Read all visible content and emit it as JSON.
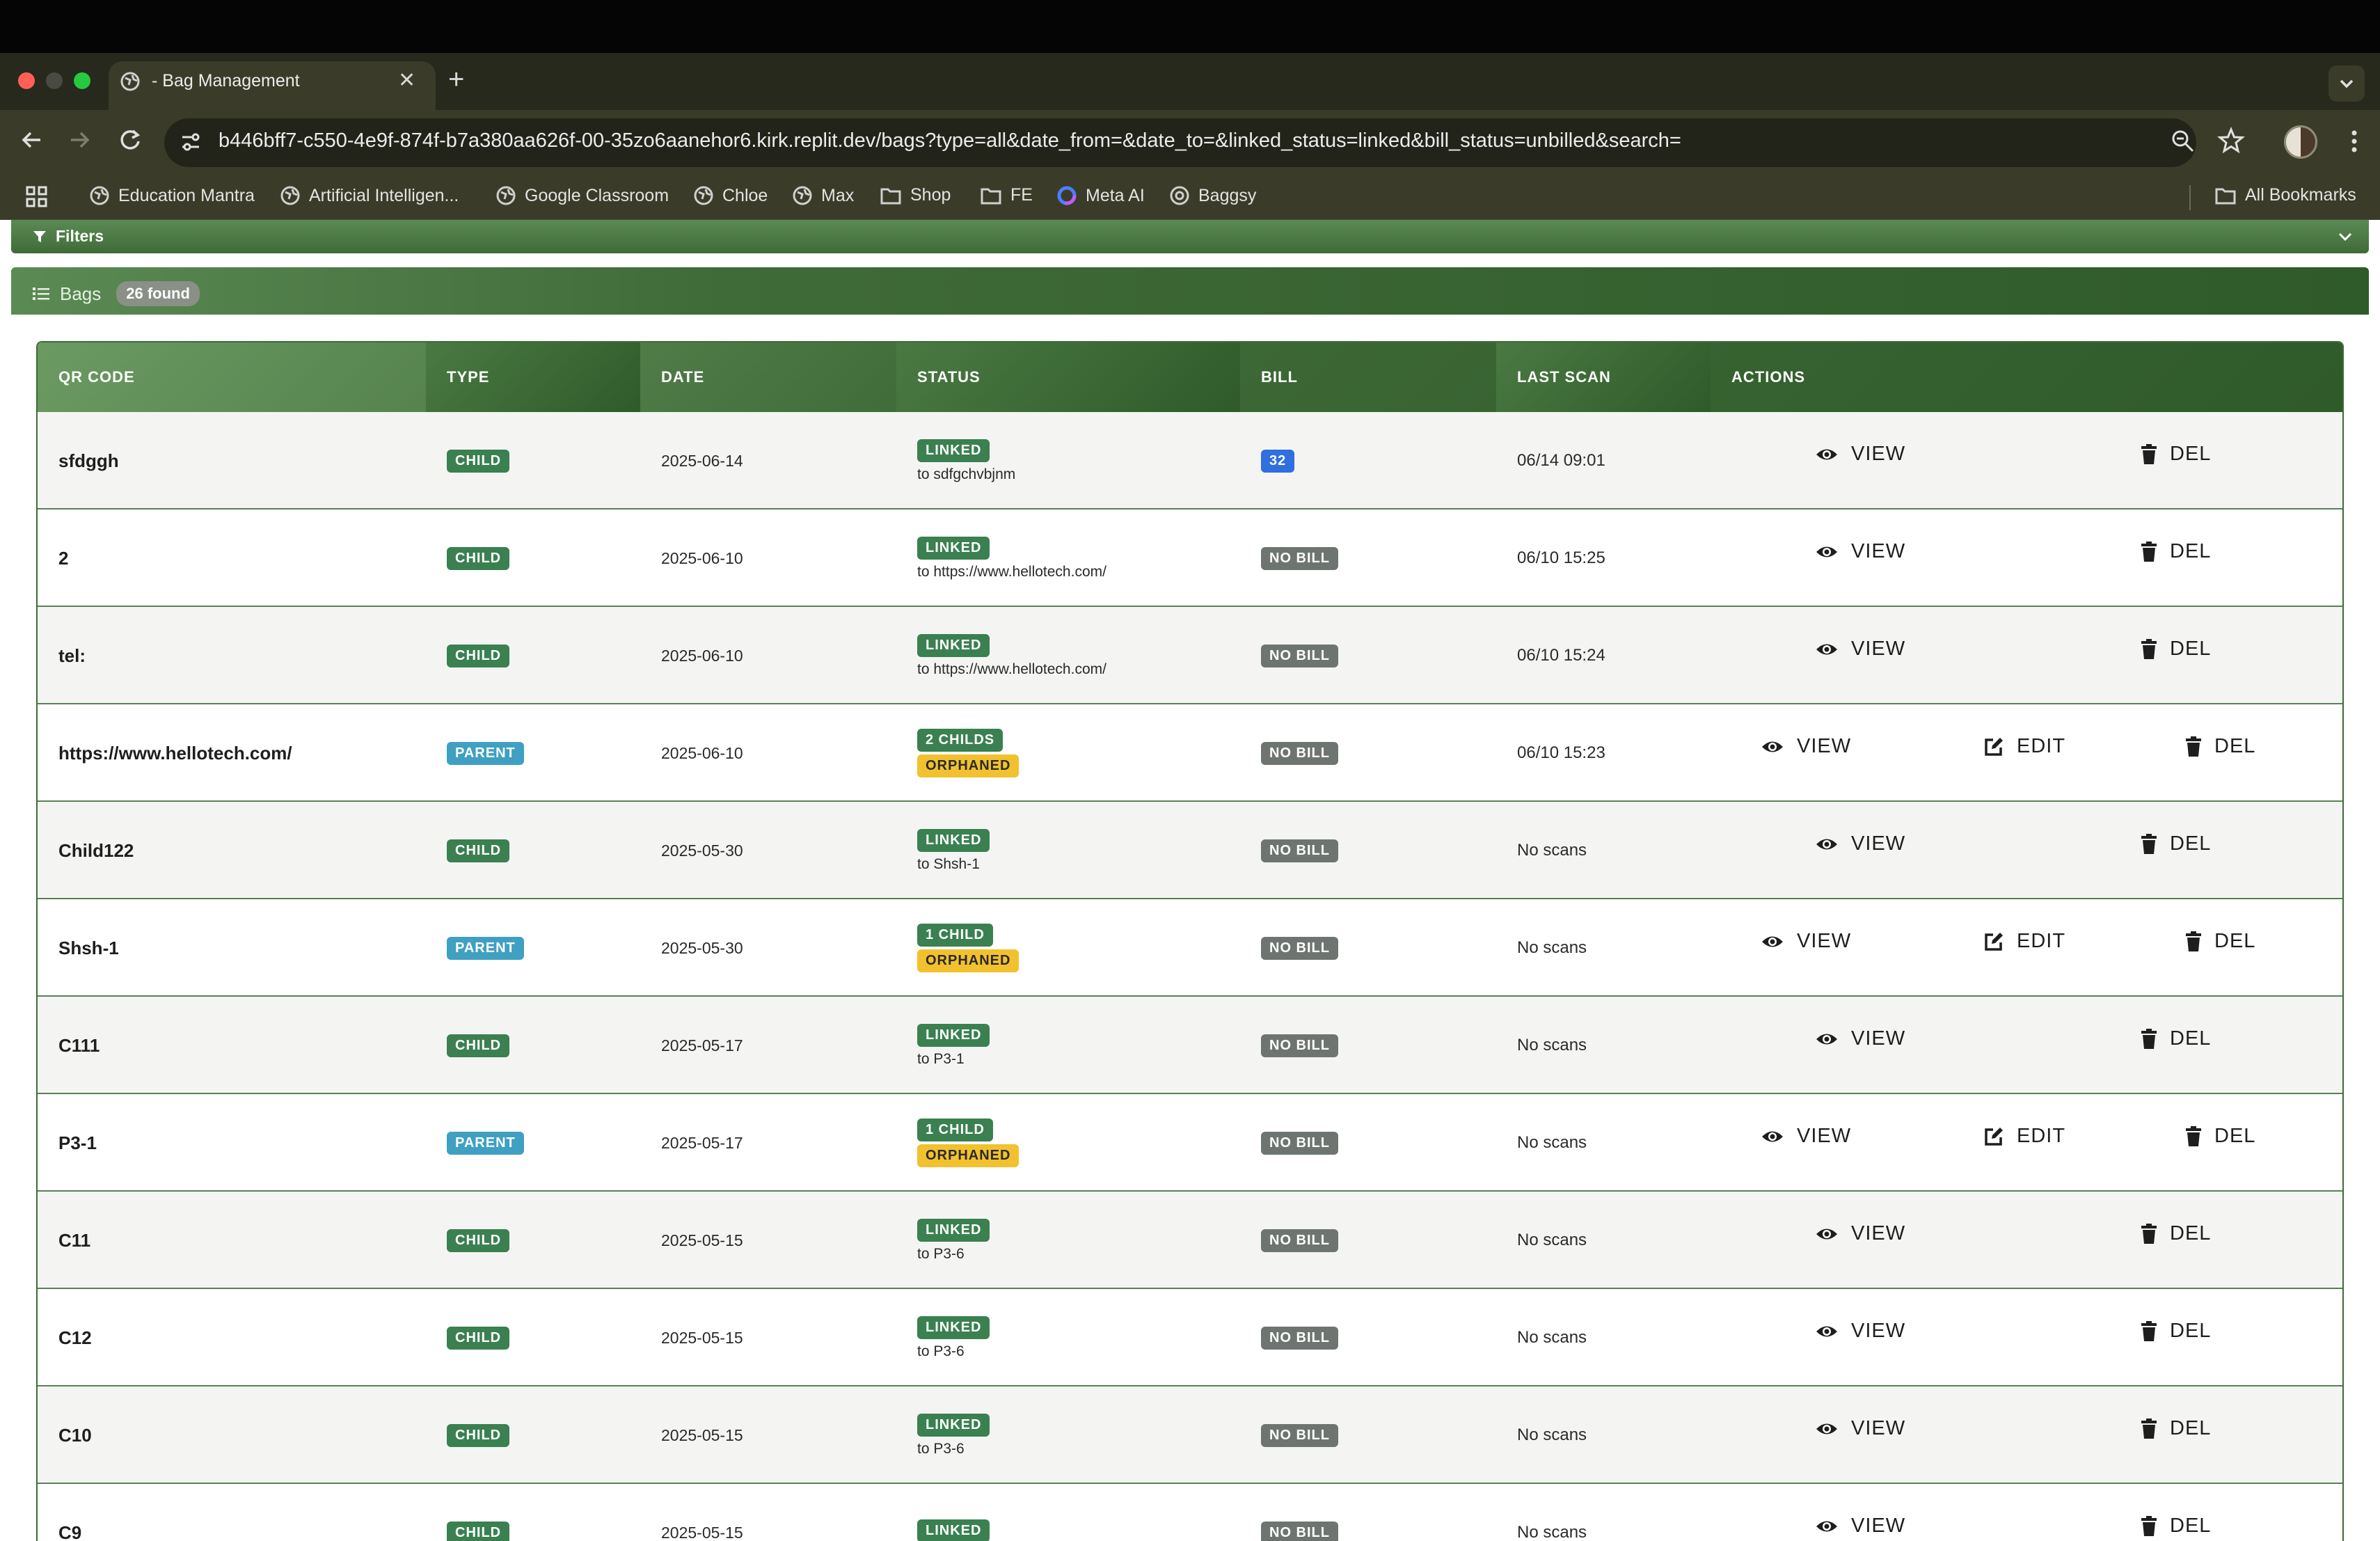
{
  "browser": {
    "tab_title": "- Bag Management",
    "url": "b446bff7-c550-4e9f-874f-b7a380aa626f-00-35zo6aanehor6.kirk.replit.dev/bags?type=all&date_from=&date_to=&linked_status=linked&bill_status=unbilled&search=",
    "bookmarks": [
      "Education Mantra",
      "Artificial Intelligen...",
      "Google Classroom",
      "Chloe",
      "Max",
      "Shop",
      "FE",
      "Meta AI",
      "Baggsy"
    ],
    "all_bookmarks": "All Bookmarks"
  },
  "filters": {
    "label": "Filters"
  },
  "bags": {
    "label": "Bags",
    "count": "26 found"
  },
  "table": {
    "headers": [
      "QR CODE",
      "TYPE",
      "DATE",
      "STATUS",
      "BILL",
      "LAST SCAN",
      "ACTIONS"
    ],
    "action_labels": {
      "view": "VIEW",
      "edit": "EDIT",
      "del": "DEL"
    },
    "rows": [
      {
        "qr": "sfdggh",
        "type": "CHILD",
        "date": "2025-06-14",
        "status": "LINKED",
        "status_sub": "to sdfgchvbjnm",
        "bill": "32",
        "last_scan": "06/14 09:01"
      },
      {
        "qr": "2",
        "type": "CHILD",
        "date": "2025-06-10",
        "status": "LINKED",
        "status_sub": "to https://www.hellotech.com/",
        "bill": "NO BILL",
        "last_scan": "06/10 15:25"
      },
      {
        "qr": "tel:",
        "type": "CHILD",
        "date": "2025-06-10",
        "status": "LINKED",
        "status_sub": "to https://www.hellotech.com/",
        "bill": "NO BILL",
        "last_scan": "06/10 15:24"
      },
      {
        "qr": "https://www.hellotech.com/",
        "type": "PARENT",
        "date": "2025-06-10",
        "status": "2 CHILDS",
        "status_sub": "ORPHANED",
        "bill": "NO BILL",
        "last_scan": "06/10 15:23"
      },
      {
        "qr": "Child122",
        "type": "CHILD",
        "date": "2025-05-30",
        "status": "LINKED",
        "status_sub": "to Shsh-1",
        "bill": "NO BILL",
        "last_scan": "No scans"
      },
      {
        "qr": "Shsh-1",
        "type": "PARENT",
        "date": "2025-05-30",
        "status": "1 CHILD",
        "status_sub": "ORPHANED",
        "bill": "NO BILL",
        "last_scan": "No scans"
      },
      {
        "qr": "C111",
        "type": "CHILD",
        "date": "2025-05-17",
        "status": "LINKED",
        "status_sub": "to P3-1",
        "bill": "NO BILL",
        "last_scan": "No scans"
      },
      {
        "qr": "P3-1",
        "type": "PARENT",
        "date": "2025-05-17",
        "status": "1 CHILD",
        "status_sub": "ORPHANED",
        "bill": "NO BILL",
        "last_scan": "No scans"
      },
      {
        "qr": "C11",
        "type": "CHILD",
        "date": "2025-05-15",
        "status": "LINKED",
        "status_sub": "to P3-6",
        "bill": "NO BILL",
        "last_scan": "No scans"
      },
      {
        "qr": "C12",
        "type": "CHILD",
        "date": "2025-05-15",
        "status": "LINKED",
        "status_sub": "to P3-6",
        "bill": "NO BILL",
        "last_scan": "No scans"
      },
      {
        "qr": "C10",
        "type": "CHILD",
        "date": "2025-05-15",
        "status": "LINKED",
        "status_sub": "to P3-6",
        "bill": "NO BILL",
        "last_scan": "No scans"
      },
      {
        "qr": "C9",
        "type": "CHILD",
        "date": "2025-05-15",
        "status": "LINKED",
        "status_sub": "",
        "bill": "NO BILL",
        "last_scan": "No scans"
      }
    ]
  },
  "colors": {
    "header_green": "#3f6b38",
    "child_badge": "#3a8050",
    "parent_badge": "#3fa0c2",
    "orphaned_badge": "#f2c12e",
    "bill_badge": "#2f6fe0",
    "nobill_badge": "#6e7571"
  }
}
